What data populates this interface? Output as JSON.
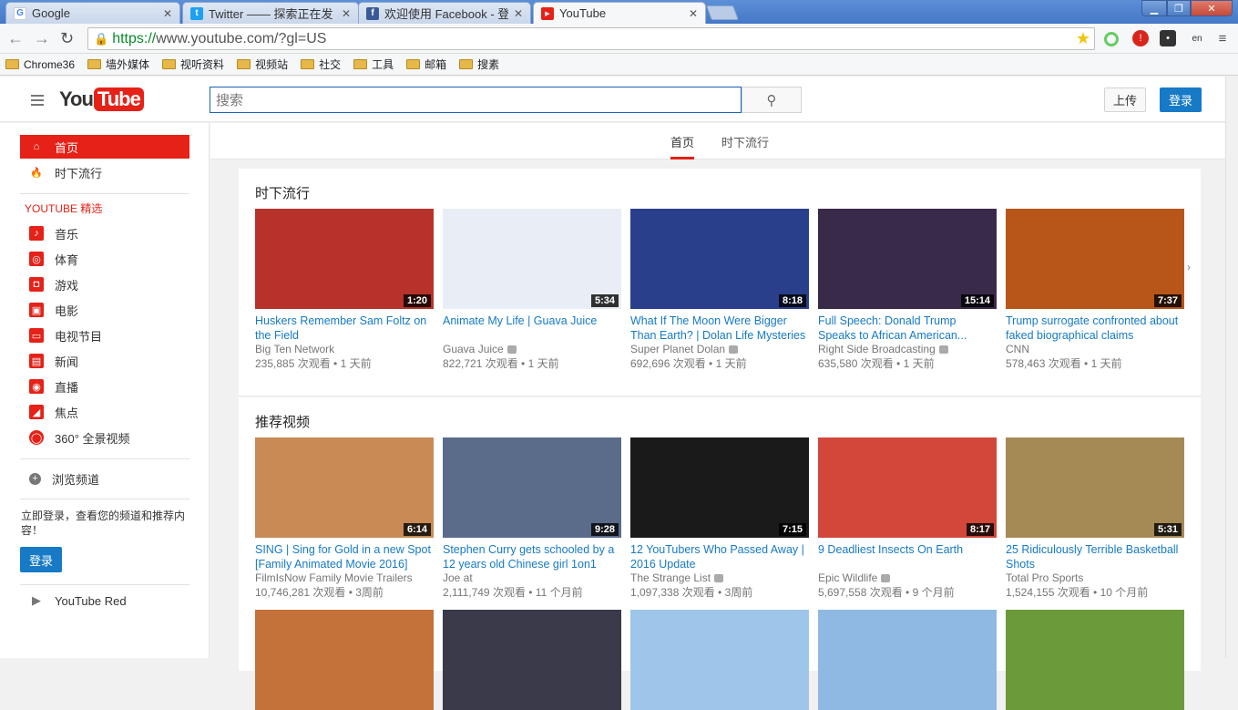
{
  "browser": {
    "tabs": [
      {
        "title": "Google",
        "icon": "google-icon",
        "color": "#4285f4"
      },
      {
        "title": "Twitter —— 探索正在发",
        "icon": "twitter-icon",
        "color": "#1da1f2"
      },
      {
        "title": "欢迎使用 Facebook - 登",
        "icon": "facebook-icon",
        "color": "#3b5998"
      },
      {
        "title": "YouTube",
        "icon": "youtube-icon",
        "color": "#e62117"
      }
    ],
    "url_scheme": "https://",
    "url_rest": "www.youtube.com/?gl=US",
    "bookmarks": [
      "Chrome36",
      "墙外媒体",
      "视听资料",
      "视频站",
      "社交",
      "工具",
      "邮箱",
      "搜素"
    ]
  },
  "header": {
    "logo_you": "You",
    "logo_tube": "Tube",
    "search_placeholder": "搜索",
    "upload_label": "上传",
    "signin_label": "登录"
  },
  "sidebar": {
    "top_items": [
      {
        "label": "首页",
        "icon": "home-icon"
      },
      {
        "label": "时下流行",
        "icon": "flame-icon"
      }
    ],
    "section_title": "YOUTUBE 精选",
    "best_of": [
      {
        "label": "音乐",
        "icon": "music-icon"
      },
      {
        "label": "体育",
        "icon": "sports-icon"
      },
      {
        "label": "游戏",
        "icon": "gaming-icon"
      },
      {
        "label": "电影",
        "icon": "movies-icon"
      },
      {
        "label": "电视节目",
        "icon": "tv-icon"
      },
      {
        "label": "新闻",
        "icon": "news-icon"
      },
      {
        "label": "直播",
        "icon": "live-icon"
      },
      {
        "label": "焦点",
        "icon": "spotlight-icon"
      },
      {
        "label": "360° 全景视频",
        "icon": "360-icon"
      }
    ],
    "browse_label": "浏览频道",
    "signin_prompt": "立即登录，查看您的频道和推荐内容！",
    "signin_button": "登录",
    "youtube_red": "YouTube Red"
  },
  "subnav": {
    "home": "首页",
    "trending": "时下流行"
  },
  "shelves": [
    {
      "title": "时下流行",
      "videos": [
        {
          "title": "Huskers Remember Sam Foltz on the Field",
          "channel": "Big Ten Network",
          "verified": false,
          "meta": "235,885 次观看 • 1 天前",
          "duration": "1:20",
          "bg": "#b8322c"
        },
        {
          "title": "Animate My Life | Guava Juice",
          "channel": "Guava Juice",
          "verified": true,
          "meta": "822,721 次观看 • 1 天前",
          "duration": "5:34",
          "bg": "#e9eef6"
        },
        {
          "title": "What If The Moon Were Bigger Than Earth? | Dolan Life Mysteries",
          "channel": "Super Planet Dolan",
          "verified": true,
          "meta": "692,696 次观看 • 1 天前",
          "duration": "8:18",
          "bg": "#2a3f8c"
        },
        {
          "title": "Full Speech: Donald Trump Speaks to African American...",
          "channel": "Right Side Broadcasting",
          "verified": true,
          "meta": "635,580 次观看 • 1 天前",
          "duration": "15:14",
          "bg": "#3a2a4a"
        },
        {
          "title": "Trump surrogate confronted about faked biographical claims",
          "channel": "CNN",
          "verified": false,
          "meta": "578,463 次观看 • 1 天前",
          "duration": "7:37",
          "bg": "#b8561a"
        }
      ]
    },
    {
      "title": "推荐视频",
      "videos": [
        {
          "title": "SING | Sing for Gold in a new Spot [Family Animated Movie 2016]",
          "channel": "FilmIsNow Family Movie Trailers",
          "verified": false,
          "meta": "10,746,281 次观看 • 3周前",
          "duration": "6:14",
          "bg": "#c98a56"
        },
        {
          "title": "Stephen Curry gets schooled by a 12 years old Chinese girl 1on1",
          "channel": "Joe at",
          "verified": false,
          "meta": "2,111,749 次观看 • 11 个月前",
          "duration": "9:28",
          "bg": "#5a6c8a"
        },
        {
          "title": "12 YouTubers Who Passed Away | 2016 Update",
          "channel": "The Strange List",
          "verified": true,
          "meta": "1,097,338 次观看 • 3周前",
          "duration": "7:15",
          "bg": "#1a1a1a"
        },
        {
          "title": "9 Deadliest Insects On Earth",
          "channel": "Epic Wildlife",
          "verified": true,
          "meta": "5,697,558 次观看 • 9 个月前",
          "duration": "8:17",
          "bg": "#d2473a"
        },
        {
          "title": "25 Ridiculously Terrible Basketball Shots",
          "channel": "Total Pro Sports",
          "verified": false,
          "meta": "1,524,155 次观看 • 10 个月前",
          "duration": "5:31",
          "bg": "#a58a56"
        }
      ]
    }
  ],
  "third_row_bgs": [
    "#c4723a",
    "#3a3a4a",
    "#9ec6ea",
    "#8fb8e2",
    "#6a9a3a"
  ]
}
